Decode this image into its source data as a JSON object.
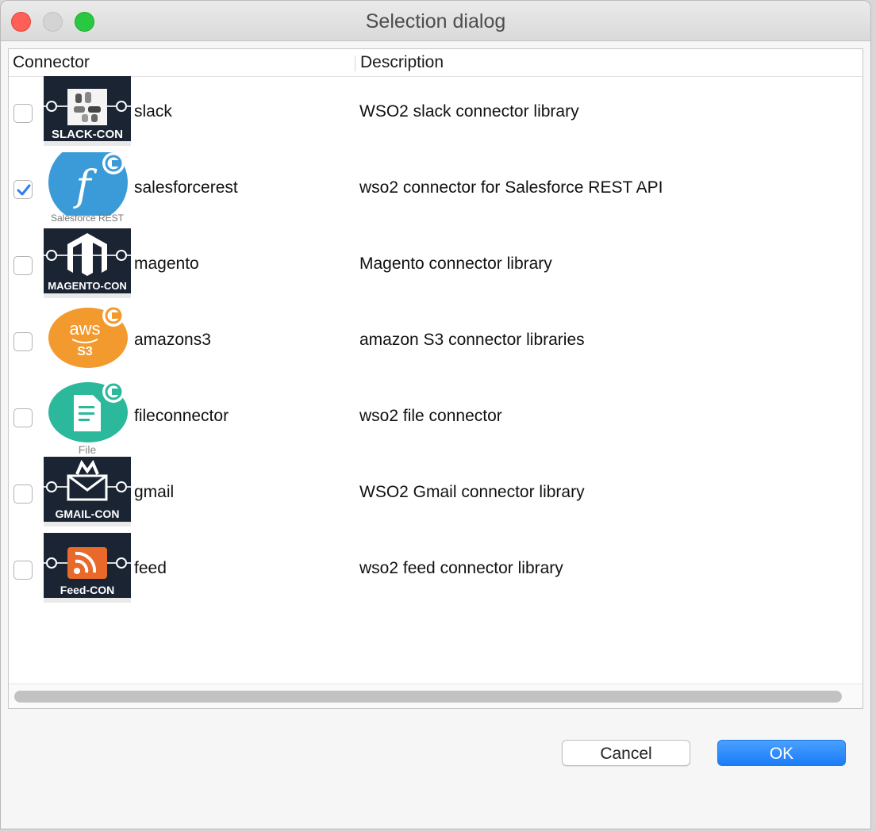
{
  "window": {
    "title": "Selection dialog"
  },
  "table": {
    "headers": {
      "connector": "Connector",
      "description": "Description"
    },
    "rows": [
      {
        "name": "slack",
        "description": "WSO2 slack connector library",
        "checked": false,
        "icon": "slack-connector-icon",
        "icon_text": "SLACK-CON"
      },
      {
        "name": "salesforcerest",
        "description": "wso2 connector for Salesforce REST API",
        "checked": true,
        "icon": "salesforce-rest-icon",
        "icon_text": "Salesforce REST"
      },
      {
        "name": "magento",
        "description": "Magento connector library",
        "checked": false,
        "icon": "magento-connector-icon",
        "icon_text": "MAGENTO-CON"
      },
      {
        "name": "amazons3",
        "description": "amazon S3 connector libraries",
        "checked": false,
        "icon": "amazon-s3-icon",
        "icon_text": "aws S3"
      },
      {
        "name": "fileconnector",
        "description": "wso2 file connector",
        "checked": false,
        "icon": "file-connector-icon",
        "icon_text": "File"
      },
      {
        "name": "gmail",
        "description": "WSO2 Gmail connector library",
        "checked": false,
        "icon": "gmail-connector-icon",
        "icon_text": "GMAIL-CON"
      },
      {
        "name": "feed",
        "description": "wso2 feed connector library",
        "checked": false,
        "icon": "feed-connector-icon",
        "icon_text": "Feed-CON"
      }
    ]
  },
  "buttons": {
    "cancel": "Cancel",
    "ok": "OK"
  },
  "colors": {
    "accent": "#1a7cf7",
    "check": "#2f7cf6"
  }
}
